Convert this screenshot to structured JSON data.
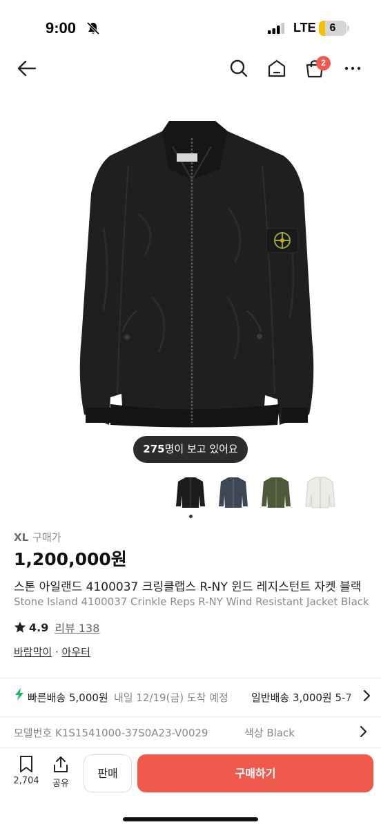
{
  "status": {
    "time": "9:00",
    "network": "LTE",
    "battery": "6"
  },
  "nav": {
    "cart_count": "2"
  },
  "product": {
    "viewers_count": "275",
    "viewers_text": "명이 보고 있어요",
    "size": "XL",
    "price_kind": "구매가",
    "price": "1,200,000원",
    "title_ko": "스톤 아일랜드 4100037 크링클랩스 R-NY 윈드 레지스턴트 자켓 블랙",
    "title_en": "Stone Island 4100037 Crinkle Reps R-NY Wind Resistant Jacket Black",
    "rating": "4.9",
    "reviews": "리뷰 138",
    "category_1": "바람막이",
    "category_sep": "·",
    "category_2": "아우터",
    "thumbnails": [
      {
        "color": "#1c1c1c",
        "label": "black"
      },
      {
        "color": "#3d4756",
        "label": "navy"
      },
      {
        "color": "#4f5a3a",
        "label": "olive"
      },
      {
        "color": "#ebebe8",
        "label": "white"
      }
    ]
  },
  "shipping": {
    "fast": "빠른배송 5,000원",
    "fast_eta": "내일 12/19(금) 도착 예정",
    "normal": "일반배송 3,000원 5-7"
  },
  "details": {
    "model_label": "모델번호",
    "model_value": "K1S1541000-37S0A23-V0029",
    "color_label": "색상",
    "color_value": "Black"
  },
  "bottom": {
    "bookmark_count": "2,704",
    "share_label": "공유",
    "sell_label": "판매",
    "buy_label": "구매하기"
  }
}
